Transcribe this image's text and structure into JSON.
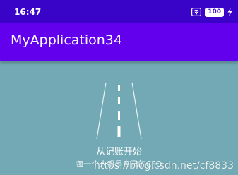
{
  "status_bar": {
    "time": "16:47",
    "battery": "100",
    "icons": [
      "wifi-icon",
      "battery-icon",
      "charging-icon"
    ]
  },
  "app_bar": {
    "title": "MyApplication34"
  },
  "content": {
    "headline": "从记账开始",
    "subline": "每一个人都是自己的CFO"
  },
  "watermark": "https://blog.csdn.net/cf8833",
  "colors": {
    "status_bar": "#3a03c8",
    "app_bar": "#6200ee",
    "background": "#72a9b4"
  }
}
